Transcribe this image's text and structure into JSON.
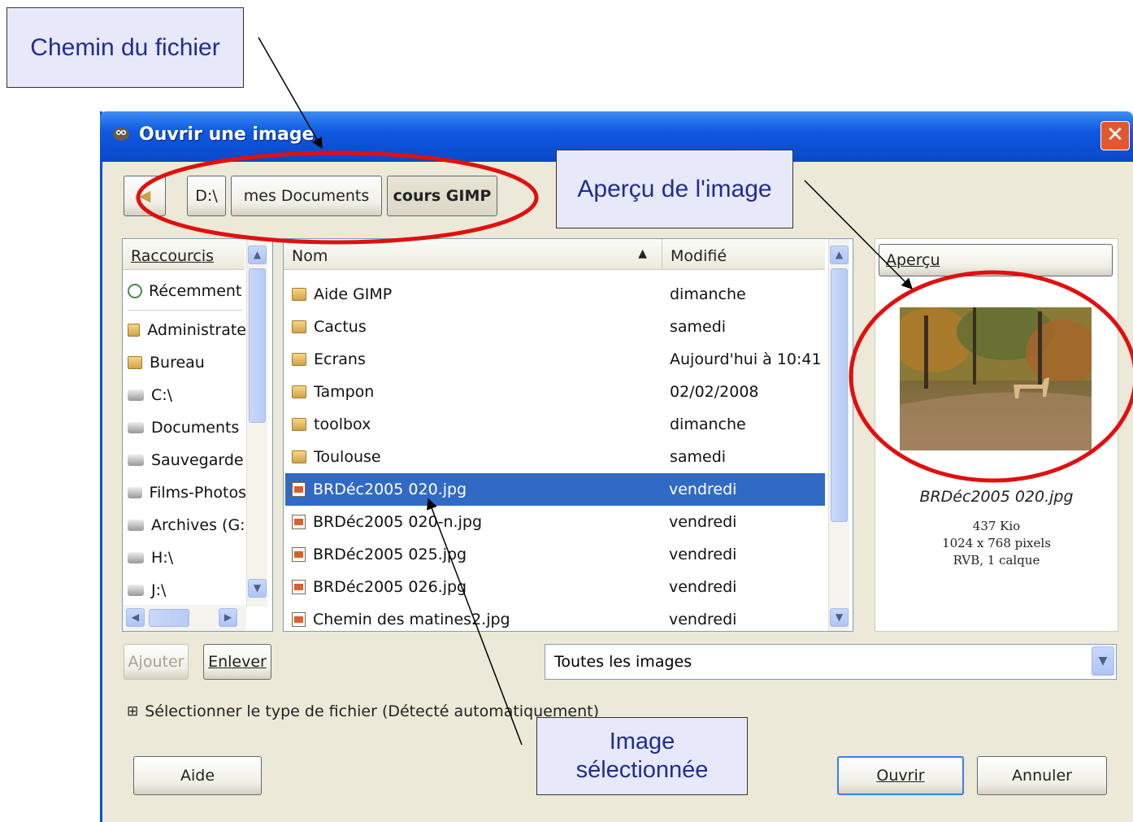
{
  "annotations": {
    "path_label": "Chemin du fichier",
    "preview_label": "Aperçu de l'image",
    "selected_label": "Image sélectionnée"
  },
  "window": {
    "title": "Ouvrir une image",
    "close_symbol": "✕"
  },
  "path_bar": {
    "back_symbol": "◀",
    "segments": [
      "D:\\",
      "mes Documents",
      "cours GIMP"
    ]
  },
  "shortcuts": {
    "header": "Raccourcis",
    "items": [
      {
        "label": "Récemment",
        "icon": "recent-icon"
      },
      {
        "label": "Administrate",
        "icon": "folder-icon"
      },
      {
        "label": "Bureau",
        "icon": "folder-icon"
      },
      {
        "label": "C:\\",
        "icon": "drive-icon"
      },
      {
        "label": "Documents",
        "icon": "drive-icon"
      },
      {
        "label": "Sauvegarde",
        "icon": "drive-icon"
      },
      {
        "label": "Films-Photos",
        "icon": "drive-icon"
      },
      {
        "label": "Archives (G:",
        "icon": "drive-icon"
      },
      {
        "label": "H:\\",
        "icon": "drive-icon"
      },
      {
        "label": "J:\\",
        "icon": "drive-icon"
      }
    ]
  },
  "files": {
    "col_name": "Nom",
    "col_modified": "Modifié",
    "sort_symbol": "▲",
    "rows": [
      {
        "name": "Aide GIMP",
        "modified": "dimanche",
        "type": "folder"
      },
      {
        "name": "Cactus",
        "modified": "samedi",
        "type": "folder"
      },
      {
        "name": "Ecrans",
        "modified": "Aujourd'hui à 10:41",
        "type": "folder"
      },
      {
        "name": "Tampon",
        "modified": "02/02/2008",
        "type": "folder"
      },
      {
        "name": "toolbox",
        "modified": "dimanche",
        "type": "folder"
      },
      {
        "name": "Toulouse",
        "modified": "samedi",
        "type": "folder"
      },
      {
        "name": "BRDéc2005 020.jpg",
        "modified": "vendredi",
        "type": "image",
        "selected": true
      },
      {
        "name": "BRDéc2005 020-n.jpg",
        "modified": "vendredi",
        "type": "image"
      },
      {
        "name": "BRDéc2005 025.jpg",
        "modified": "vendredi",
        "type": "image"
      },
      {
        "name": "BRDéc2005 026.jpg",
        "modified": "vendredi",
        "type": "image"
      },
      {
        "name": "Chemin des matines2.jpg",
        "modified": "vendredi",
        "type": "image"
      }
    ]
  },
  "preview": {
    "button": "Aperçu",
    "filename": "BRDéc2005 020.jpg",
    "size": "437 Kio",
    "dimensions": "1024 x 768 pixels",
    "info": "RVB, 1 calque"
  },
  "buttons": {
    "add": "Ajouter",
    "remove": "Enlever",
    "help": "Aide",
    "open": "Ouvrir",
    "cancel": "Annuler"
  },
  "filter": {
    "selected": "Toutes les images",
    "expander_symbol": "⊞",
    "file_type_label": "Sélectionner le type de fichier (Détecté automatiquement)"
  },
  "colors": {
    "selection": "#316ac5",
    "title_bar": "#0b4cd0",
    "annotation_ellipse": "#e01010"
  }
}
